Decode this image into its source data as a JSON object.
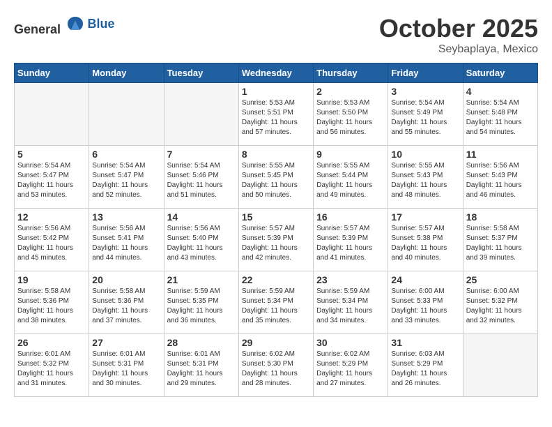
{
  "logo": {
    "general": "General",
    "blue": "Blue"
  },
  "header": {
    "month": "October 2025",
    "location": "Seybaplaya, Mexico"
  },
  "weekdays": [
    "Sunday",
    "Monday",
    "Tuesday",
    "Wednesday",
    "Thursday",
    "Friday",
    "Saturday"
  ],
  "weeks": [
    [
      {
        "day": "",
        "info": ""
      },
      {
        "day": "",
        "info": ""
      },
      {
        "day": "",
        "info": ""
      },
      {
        "day": "1",
        "info": "Sunrise: 5:53 AM\nSunset: 5:51 PM\nDaylight: 11 hours\nand 57 minutes."
      },
      {
        "day": "2",
        "info": "Sunrise: 5:53 AM\nSunset: 5:50 PM\nDaylight: 11 hours\nand 56 minutes."
      },
      {
        "day": "3",
        "info": "Sunrise: 5:54 AM\nSunset: 5:49 PM\nDaylight: 11 hours\nand 55 minutes."
      },
      {
        "day": "4",
        "info": "Sunrise: 5:54 AM\nSunset: 5:48 PM\nDaylight: 11 hours\nand 54 minutes."
      }
    ],
    [
      {
        "day": "5",
        "info": "Sunrise: 5:54 AM\nSunset: 5:47 PM\nDaylight: 11 hours\nand 53 minutes."
      },
      {
        "day": "6",
        "info": "Sunrise: 5:54 AM\nSunset: 5:47 PM\nDaylight: 11 hours\nand 52 minutes."
      },
      {
        "day": "7",
        "info": "Sunrise: 5:54 AM\nSunset: 5:46 PM\nDaylight: 11 hours\nand 51 minutes."
      },
      {
        "day": "8",
        "info": "Sunrise: 5:55 AM\nSunset: 5:45 PM\nDaylight: 11 hours\nand 50 minutes."
      },
      {
        "day": "9",
        "info": "Sunrise: 5:55 AM\nSunset: 5:44 PM\nDaylight: 11 hours\nand 49 minutes."
      },
      {
        "day": "10",
        "info": "Sunrise: 5:55 AM\nSunset: 5:43 PM\nDaylight: 11 hours\nand 48 minutes."
      },
      {
        "day": "11",
        "info": "Sunrise: 5:56 AM\nSunset: 5:43 PM\nDaylight: 11 hours\nand 46 minutes."
      }
    ],
    [
      {
        "day": "12",
        "info": "Sunrise: 5:56 AM\nSunset: 5:42 PM\nDaylight: 11 hours\nand 45 minutes."
      },
      {
        "day": "13",
        "info": "Sunrise: 5:56 AM\nSunset: 5:41 PM\nDaylight: 11 hours\nand 44 minutes."
      },
      {
        "day": "14",
        "info": "Sunrise: 5:56 AM\nSunset: 5:40 PM\nDaylight: 11 hours\nand 43 minutes."
      },
      {
        "day": "15",
        "info": "Sunrise: 5:57 AM\nSunset: 5:39 PM\nDaylight: 11 hours\nand 42 minutes."
      },
      {
        "day": "16",
        "info": "Sunrise: 5:57 AM\nSunset: 5:39 PM\nDaylight: 11 hours\nand 41 minutes."
      },
      {
        "day": "17",
        "info": "Sunrise: 5:57 AM\nSunset: 5:38 PM\nDaylight: 11 hours\nand 40 minutes."
      },
      {
        "day": "18",
        "info": "Sunrise: 5:58 AM\nSunset: 5:37 PM\nDaylight: 11 hours\nand 39 minutes."
      }
    ],
    [
      {
        "day": "19",
        "info": "Sunrise: 5:58 AM\nSunset: 5:36 PM\nDaylight: 11 hours\nand 38 minutes."
      },
      {
        "day": "20",
        "info": "Sunrise: 5:58 AM\nSunset: 5:36 PM\nDaylight: 11 hours\nand 37 minutes."
      },
      {
        "day": "21",
        "info": "Sunrise: 5:59 AM\nSunset: 5:35 PM\nDaylight: 11 hours\nand 36 minutes."
      },
      {
        "day": "22",
        "info": "Sunrise: 5:59 AM\nSunset: 5:34 PM\nDaylight: 11 hours\nand 35 minutes."
      },
      {
        "day": "23",
        "info": "Sunrise: 5:59 AM\nSunset: 5:34 PM\nDaylight: 11 hours\nand 34 minutes."
      },
      {
        "day": "24",
        "info": "Sunrise: 6:00 AM\nSunset: 5:33 PM\nDaylight: 11 hours\nand 33 minutes."
      },
      {
        "day": "25",
        "info": "Sunrise: 6:00 AM\nSunset: 5:32 PM\nDaylight: 11 hours\nand 32 minutes."
      }
    ],
    [
      {
        "day": "26",
        "info": "Sunrise: 6:01 AM\nSunset: 5:32 PM\nDaylight: 11 hours\nand 31 minutes."
      },
      {
        "day": "27",
        "info": "Sunrise: 6:01 AM\nSunset: 5:31 PM\nDaylight: 11 hours\nand 30 minutes."
      },
      {
        "day": "28",
        "info": "Sunrise: 6:01 AM\nSunset: 5:31 PM\nDaylight: 11 hours\nand 29 minutes."
      },
      {
        "day": "29",
        "info": "Sunrise: 6:02 AM\nSunset: 5:30 PM\nDaylight: 11 hours\nand 28 minutes."
      },
      {
        "day": "30",
        "info": "Sunrise: 6:02 AM\nSunset: 5:29 PM\nDaylight: 11 hours\nand 27 minutes."
      },
      {
        "day": "31",
        "info": "Sunrise: 6:03 AM\nSunset: 5:29 PM\nDaylight: 11 hours\nand 26 minutes."
      },
      {
        "day": "",
        "info": ""
      }
    ]
  ]
}
